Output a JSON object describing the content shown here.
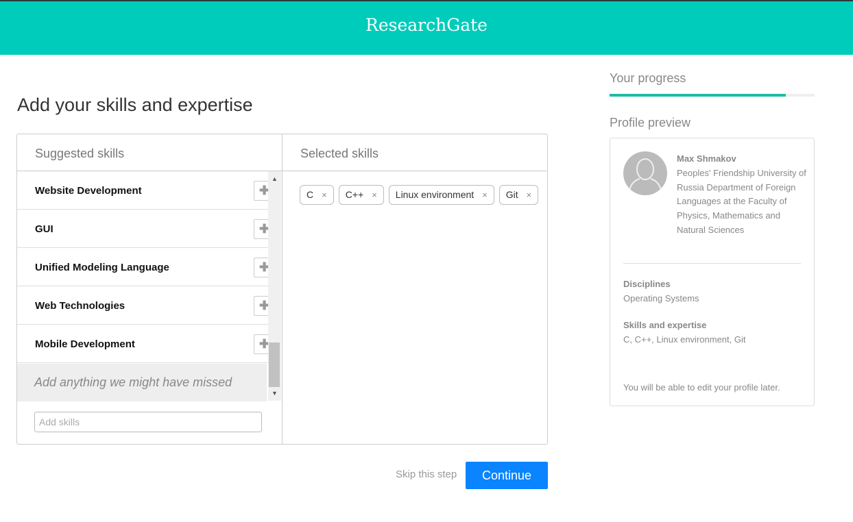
{
  "header": {
    "logo": "ResearchGate"
  },
  "page_title": "Add your skills and expertise",
  "suggested": {
    "heading": "Suggested skills",
    "items": [
      "Website Development",
      "GUI",
      "Unified Modeling Language",
      "Web Technologies",
      "Mobile Development"
    ],
    "add_icon": "plus-icon",
    "missed": "Add anything we might have missed",
    "input_placeholder": "Add skills"
  },
  "selected": {
    "heading": "Selected skills",
    "chips": [
      "C",
      "C++",
      "Linux environment",
      "Git"
    ],
    "remove_icon": "×"
  },
  "actions": {
    "skip": "Skip this step",
    "continue": "Continue"
  },
  "progress": {
    "label": "Your progress",
    "value": 0.86
  },
  "preview": {
    "heading": "Profile preview",
    "name": "Max Shmakov",
    "affiliation": "Peoples' Friendship University of Russia Department of Foreign Languages at the Faculty of Physics, Mathematics and Natural Sciences",
    "disciplines_label": "Disciplines",
    "disciplines": "Operating Systems",
    "skills_label": "Skills and expertise",
    "skills": "C, C++, Linux environment, Git",
    "note": "You will be able to edit your profile later."
  },
  "colors": {
    "brand": "#00ccbb",
    "progress": "#1dbba4",
    "button": "#0a84ff"
  }
}
